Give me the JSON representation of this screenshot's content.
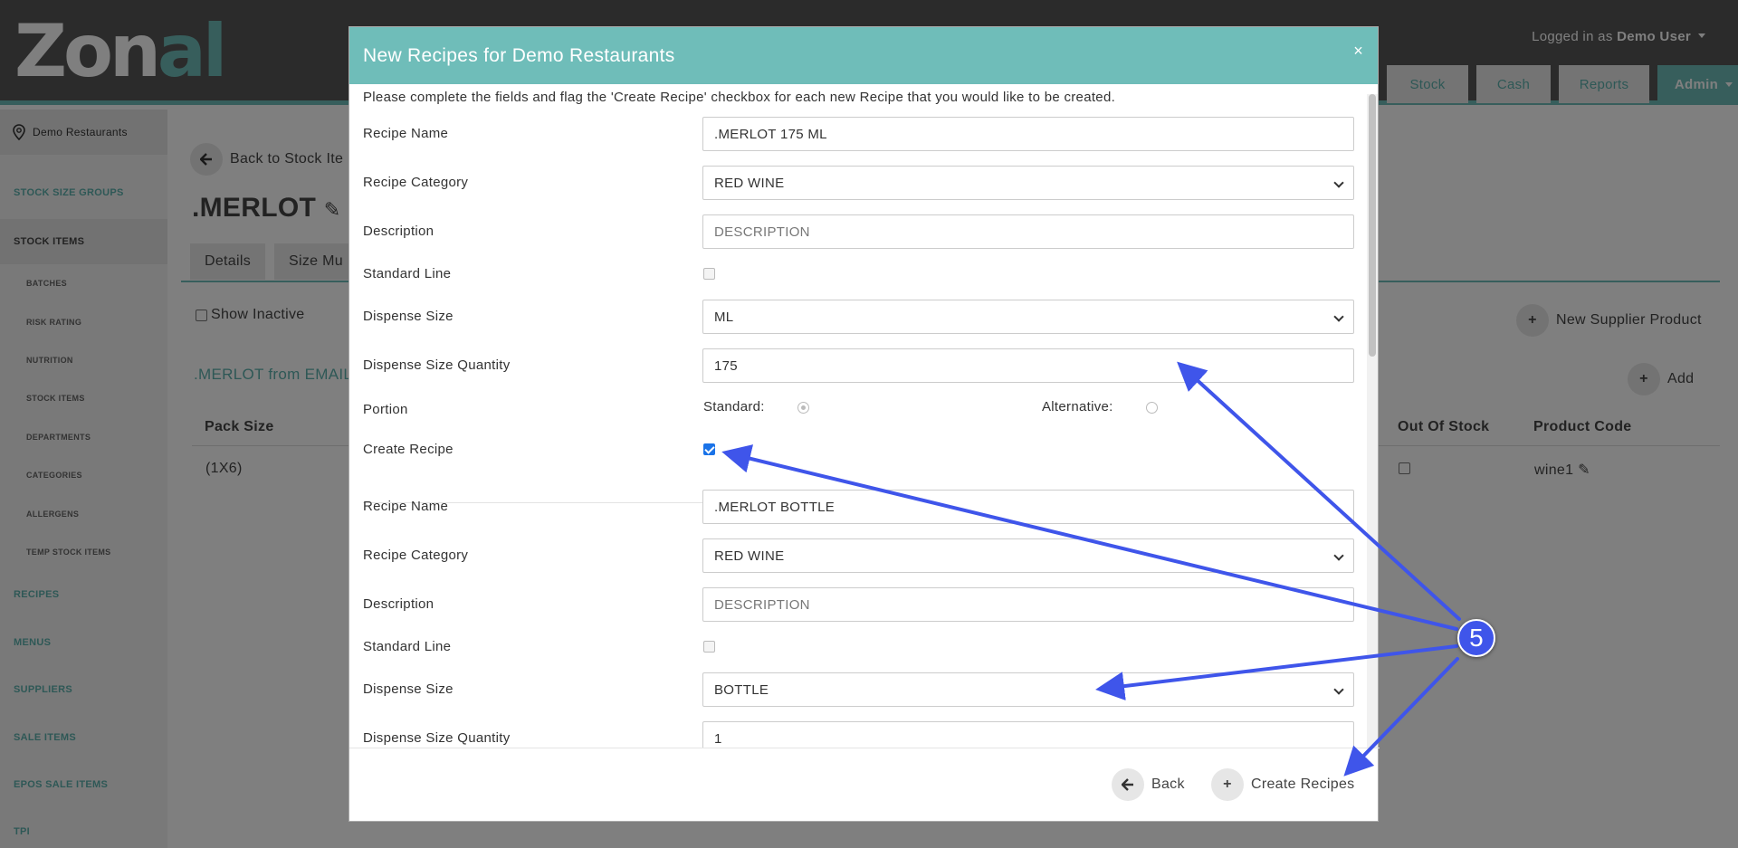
{
  "header": {
    "logo_main": "Zon",
    "logo_accent": "al",
    "logged_in_prefix": "Logged in as",
    "user_name": "Demo User",
    "nav": [
      "Stock",
      "Cash",
      "Reports",
      "Admin"
    ]
  },
  "sidebar": {
    "location": "Demo Restaurants",
    "sections": [
      "STOCK SIZE GROUPS",
      "STOCK ITEMS",
      "RECIPES",
      "MENUS",
      "SUPPLIERS",
      "SALE ITEMS",
      "EPOS SALE ITEMS",
      "TPI"
    ],
    "sub_items": [
      "BATCHES",
      "RISK RATING",
      "NUTRITION",
      "STOCK ITEMS",
      "DEPARTMENTS",
      "CATEGORIES",
      "ALLERGENS",
      "TEMP STOCK ITEMS"
    ]
  },
  "main": {
    "back_label": "Back to Stock Ite",
    "title": ".MERLOT",
    "tabs": [
      "Details",
      "Size Mu"
    ],
    "show_inactive": "Show Inactive",
    "new_supplier": "New Supplier Product",
    "add": "Add",
    "section_title": ".MERLOT from EMAIL",
    "columns": {
      "pack_size": "Pack Size",
      "out_of_stock": "Out Of Stock",
      "product_code": "Product Code"
    },
    "row": {
      "pack_size": "(1X6)",
      "product_code": "wine1"
    }
  },
  "modal": {
    "title": "New Recipes for Demo Restaurants",
    "close": "×",
    "intro": "Please complete the fields and flag the 'Create Recipe' checkbox for each new Recipe that you would like to be created.",
    "labels": {
      "recipe_name": "Recipe Name",
      "recipe_category": "Recipe Category",
      "description": "Description",
      "standard_line": "Standard Line",
      "dispense_size": "Dispense Size",
      "dispense_size_quantity": "Dispense Size Quantity",
      "portion": "Portion",
      "create_recipe": "Create Recipe",
      "standard": "Standard:",
      "alternative": "Alternative:"
    },
    "recipes": [
      {
        "name": ".MERLOT 175 ML",
        "category": "RED WINE",
        "description_placeholder": "DESCRIPTION",
        "dispense_size": "ML",
        "quantity": "175",
        "create_recipe": true
      },
      {
        "name": ".MERLOT BOTTLE",
        "category": "RED WINE",
        "description_placeholder": "DESCRIPTION",
        "dispense_size": "BOTTLE",
        "quantity": "1"
      }
    ],
    "buttons": {
      "back": "Back",
      "create": "Create Recipes"
    }
  },
  "annotation": {
    "step": "5",
    "color": "#3f55ea"
  }
}
